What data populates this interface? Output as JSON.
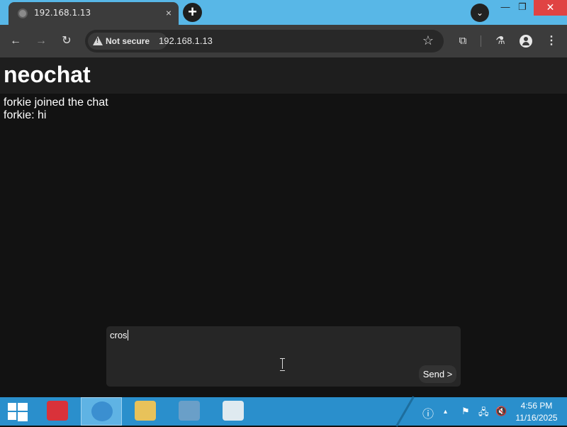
{
  "browser": {
    "tab": {
      "title": "192.168.1.13",
      "favicon": "globe-icon",
      "close": "×"
    },
    "new_tab": "+",
    "window_controls": {
      "minimize": "—",
      "restore": "❐",
      "close": "✕"
    },
    "tab_search": "⌄",
    "nav": {
      "back": "←",
      "forward": "→",
      "reload": "↻"
    },
    "security_label": "Not secure",
    "url": "192.168.1.13",
    "icons": {
      "bookmark": "☆",
      "extensions": "⧉",
      "labs": "⚗",
      "menu": "⋮"
    }
  },
  "app": {
    "title": "neochat",
    "messages": [
      "forkie joined the chat",
      "forkie: hi"
    ],
    "composer": {
      "value": "cros"
    },
    "send_label": "Send >"
  },
  "taskbar": {
    "apps": [
      {
        "name": "file-manager-app",
        "color": "#d9323a",
        "active": false
      },
      {
        "name": "browser-app",
        "color": "#3b8fd0",
        "active": true
      },
      {
        "name": "folder-app",
        "color": "#e8c25a",
        "active": false
      },
      {
        "name": "control-panel-app",
        "color": "#6a9fc8",
        "active": false
      },
      {
        "name": "document-viewer-app",
        "color": "#dfeaf0",
        "active": false
      }
    ],
    "tray": {
      "info": "ⓘ",
      "expand": "▴",
      "flag": "⚑",
      "network": "🖧",
      "volume": "🔇"
    },
    "clock": {
      "time": "4:56 PM",
      "date": "11/16/2025"
    }
  },
  "colors": {
    "tabstrip": "#58b7e7",
    "chrome_dark": "#3c3c3c",
    "page_bg": "#121212",
    "header_bg": "#1e1e1e",
    "taskbar": "#2a8fcc",
    "close_red": "#e04343"
  }
}
